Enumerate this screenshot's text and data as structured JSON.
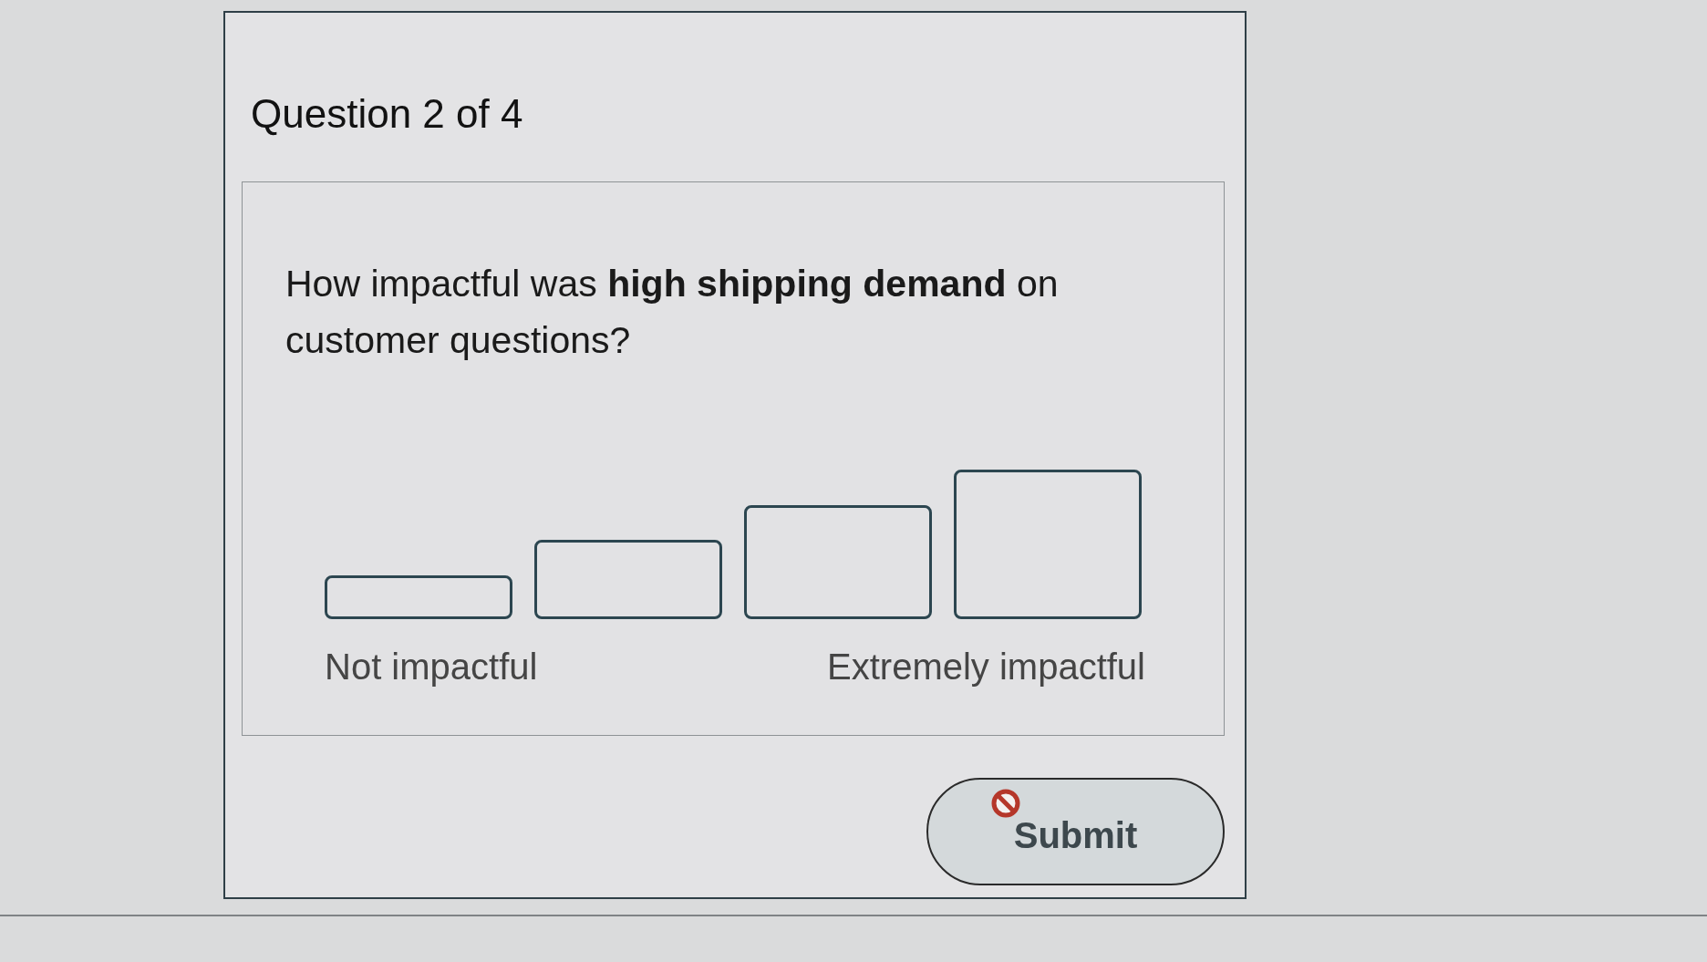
{
  "question_header": {
    "title": "Question 2 of 4"
  },
  "question": {
    "text": "How impactful was **high shipping demand** on customer questions?",
    "scale": {
      "options": [
        {
          "selected": false
        },
        {
          "selected": false
        },
        {
          "selected": false
        },
        {
          "selected": false
        }
      ],
      "low_label": "Not impactful",
      "high_label": "Extremely impactful"
    }
  },
  "submit_button": {
    "label": "Submit",
    "disabled": true
  }
}
